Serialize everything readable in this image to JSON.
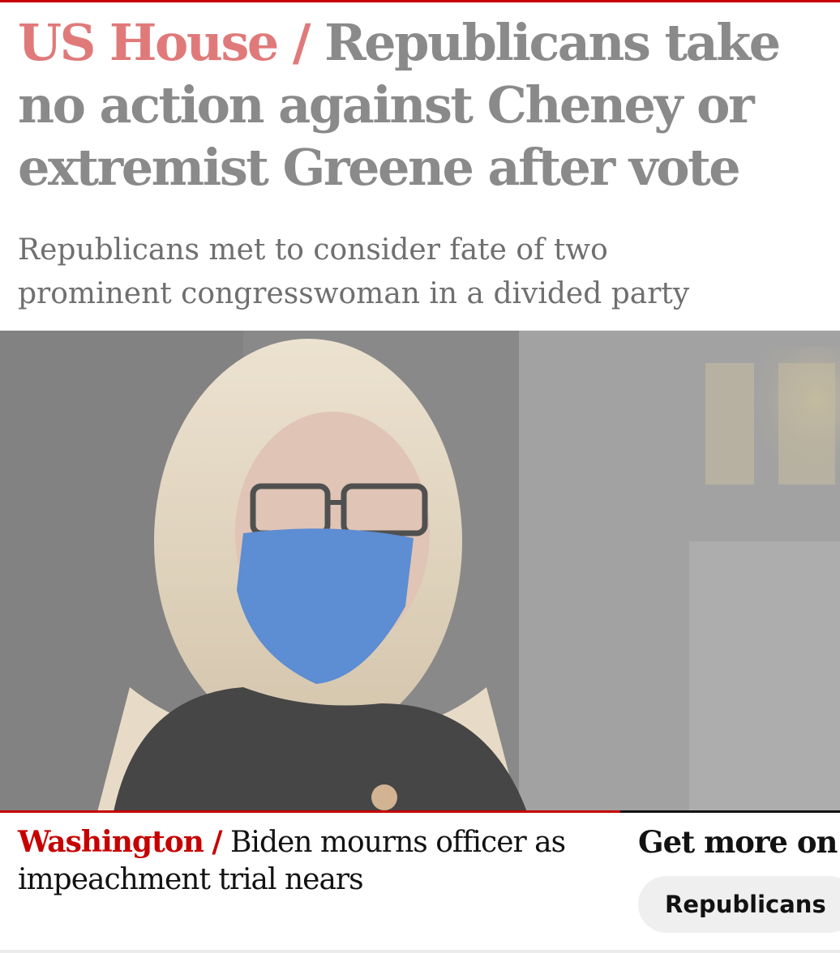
{
  "headline": {
    "kicker": "US House",
    "separator": "/",
    "title": "Republicans take no action against Cheney or extremist Greene after vote"
  },
  "standfirst": "Republicans met to consider fate of two prominent congresswoman in a divided party",
  "hero_image": {
    "alt": "Photo"
  },
  "related_card": {
    "kicker": "Washington",
    "separator": "/",
    "title": "Biden mourns officer as impeachment trial nears",
    "accent": "#c70000"
  },
  "more_on": {
    "title": "Get more on t",
    "tags": [
      "Republicans"
    ]
  },
  "colors": {
    "brand_red": "#c70000",
    "headline_grey": "#8a8a8a",
    "kicker_faded": "#e07a7a"
  }
}
